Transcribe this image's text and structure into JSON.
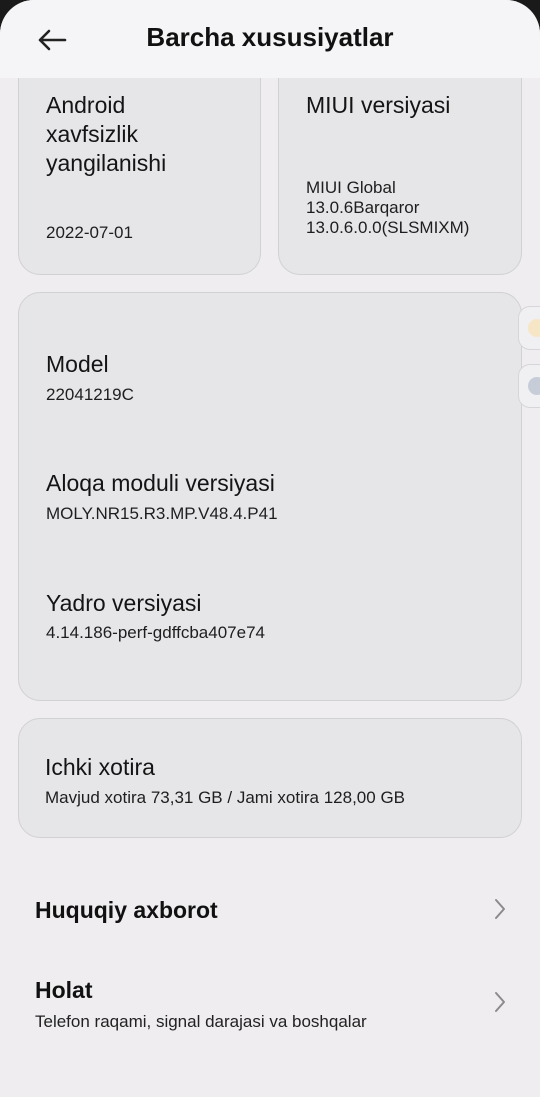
{
  "header": {
    "title": "Barcha xususiyatlar"
  },
  "cards": {
    "security_patch": {
      "label_lines": [
        "Android",
        "xavfsizlik",
        "yangilanishi"
      ],
      "value": "2022-07-01"
    },
    "miui_version": {
      "label": "MIUI versiyasi",
      "value_lines": [
        "MIUI Global",
        "13.0.6Barqaror",
        "13.0.6.0.0(SLSMIXM)"
      ]
    },
    "details": {
      "model_label": "Model",
      "model_value": "22041219C",
      "baseband_label": "Aloqa moduli versiyasi",
      "baseband_value": "MOLY.NR15.R3.MP.V48.4.P41",
      "kernel_label": "Yadro versiyasi",
      "kernel_value": "4.14.186-perf-gdffcba407e74"
    },
    "storage": {
      "label": "Ichki xotira",
      "value": "Mavjud xotira  73,31 GB / Jami xotira  128,00 GB"
    }
  },
  "list": {
    "legal": {
      "title": "Huquqiy axborot"
    },
    "status": {
      "title": "Holat",
      "subtitle": "Telefon raqami, signal darajasi va boshqalar"
    }
  },
  "colors": {
    "background": "#efedf0",
    "card": "#e6e5e8",
    "edge_tab_1": "#f7e6c6",
    "edge_tab_2": "#c7cdd8"
  },
  "icons": {
    "back": "arrow-left-icon",
    "chevron": "chevron-right-icon"
  }
}
